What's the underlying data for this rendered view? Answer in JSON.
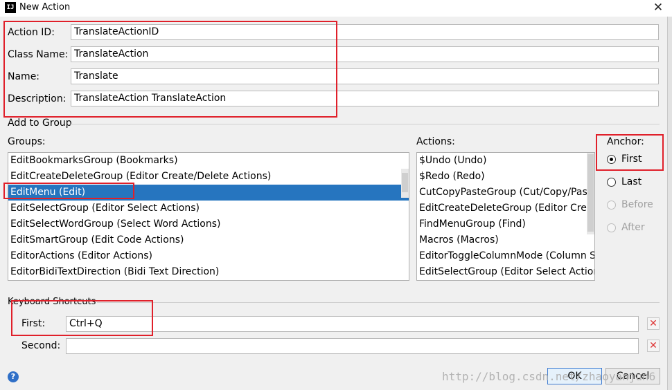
{
  "window": {
    "title": "New Action",
    "app_icon": "IJ"
  },
  "fields": {
    "action_id": {
      "label": "Action ID:",
      "value": "TranslateActionID"
    },
    "class_name": {
      "label": "Class Name:",
      "value": "TranslateAction"
    },
    "name": {
      "label": "Name:",
      "value": "Translate"
    },
    "description": {
      "label": "Description:",
      "value": "TranslateAction TranslateAction"
    }
  },
  "add_to_group": {
    "section_label": "Add to Group",
    "groups_label": "Groups:",
    "groups": [
      "EditBookmarksGroup (Bookmarks)",
      "EditCreateDeleteGroup (Editor Create/Delete Actions)",
      "EditMenu (Edit)",
      "EditSelectGroup (Editor Select Actions)",
      "EditSelectWordGroup (Select Word Actions)",
      "EditSmartGroup (Edit Code Actions)",
      "EditorActions (Editor Actions)",
      "EditorBidiTextDirection (Bidi Text Direction)"
    ],
    "groups_selected_index": 2,
    "actions_label": "Actions:",
    "actions": [
      "$Undo (Undo)",
      "$Redo (Redo)",
      "CutCopyPasteGroup (Cut/Copy/Paste",
      "EditCreateDeleteGroup (Editor Create/",
      "FindMenuGroup (Find)",
      "Macros (Macros)",
      "EditorToggleColumnMode (Column S",
      "EditSelectGroup (Editor Select Actions"
    ],
    "anchor": {
      "label": "Anchor:",
      "options": [
        {
          "label": "First",
          "selected": true,
          "enabled": true
        },
        {
          "label": "Last",
          "selected": false,
          "enabled": true
        },
        {
          "label": "Before",
          "selected": false,
          "enabled": false
        },
        {
          "label": "After",
          "selected": false,
          "enabled": false
        }
      ]
    }
  },
  "keyboard_shortcuts": {
    "section_label": "Keyboard Shortcuts",
    "first": {
      "label": "First:",
      "value": "Ctrl+Q"
    },
    "second": {
      "label": "Second:",
      "value": ""
    }
  },
  "buttons": {
    "ok": "OK",
    "cancel": "Cancel",
    "help": "?"
  },
  "watermark": "http://blog.csdn.net/zhaoyanjun6",
  "colors": {
    "selection": "#2675bf",
    "highlight_box": "#e0202a",
    "clear_icon": "#d33"
  }
}
